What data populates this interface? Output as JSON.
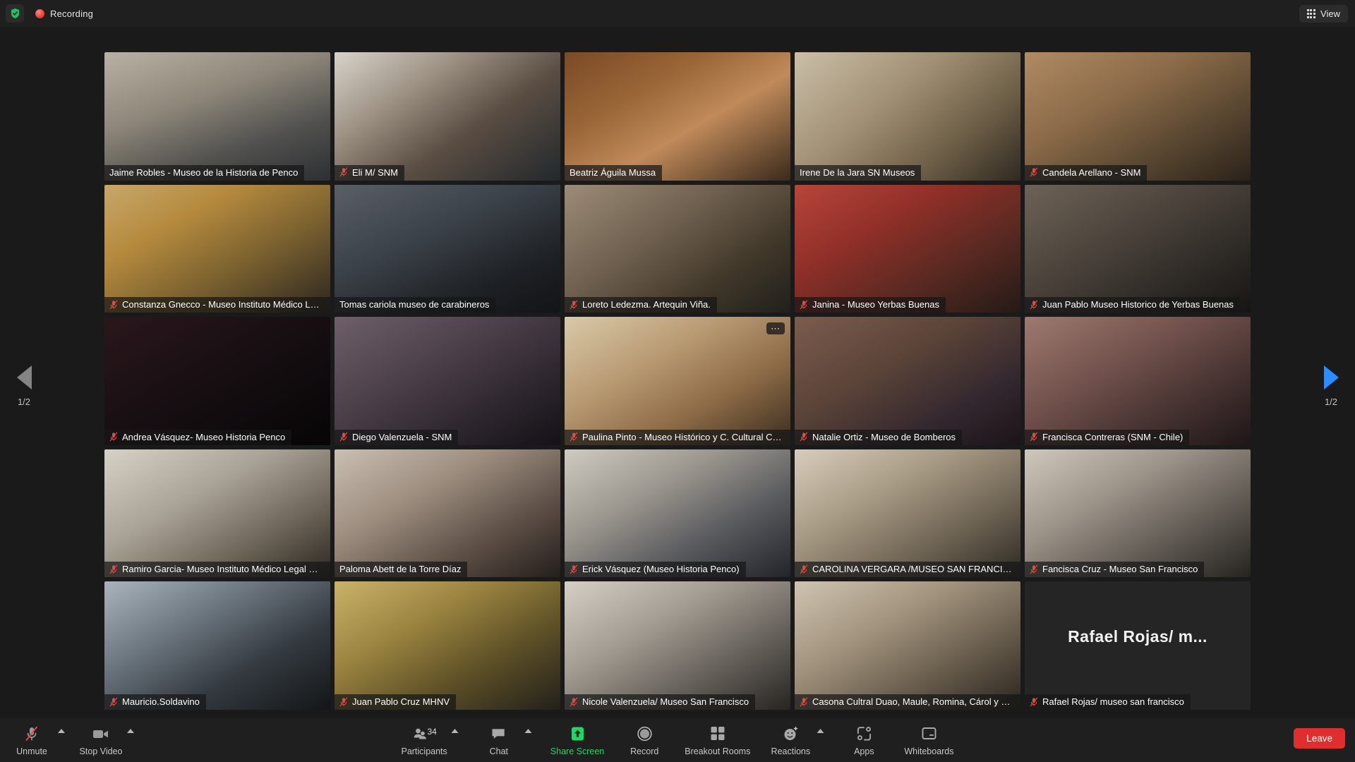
{
  "topbar": {
    "shield_icon": "shield-check-icon",
    "recording_label": "Recording",
    "view_label": "View",
    "view_icon": "grid-view-icon"
  },
  "pager": {
    "left_icon": "chevron-left-icon",
    "right_icon": "chevron-right-icon",
    "left_count": "1/2",
    "right_count": "1/2"
  },
  "tiles": [
    {
      "name": "Jaime Robles - Museo de la Historia de Penco",
      "muted": false,
      "speaking": false,
      "more": false,
      "bg": "linear-gradient(160deg,#b9b2a4 0%,#8d8679 38%,#50504e 70%,#2e2f33 100%)",
      "avatar": ""
    },
    {
      "name": "Eli M/ SNM",
      "muted": true,
      "speaking": false,
      "more": false,
      "bg": "linear-gradient(145deg,#d8d3cb 0%,#9f9486 30%,#5b4e43 60%,#22282c 100%)",
      "avatar": ""
    },
    {
      "name": "Beatriz Águila Mussa",
      "muted": false,
      "speaking": false,
      "more": false,
      "bg": "linear-gradient(150deg,#7a4a26 0%,#9a6637 32%,#c08a5a 58%,#3a2a1c 100%)",
      "avatar": ""
    },
    {
      "name": "Irene De la Jara SN Museos",
      "muted": false,
      "speaking": false,
      "more": false,
      "bg": "linear-gradient(140deg,#cbbfa8 0%,#a08f73 40%,#6b5c45 72%,#2f2a22 100%)",
      "avatar": ""
    },
    {
      "name": "Candela Arellano - SNM",
      "muted": true,
      "speaking": false,
      "more": false,
      "bg": "linear-gradient(150deg,#b08b63 0%,#8a6a48 38%,#5d4a33 66%,#2a2219 100%)",
      "avatar": ""
    },
    {
      "name": "Constanza Gnecco - Museo Instituto Médico Leg...",
      "muted": true,
      "speaking": false,
      "more": false,
      "bg": "linear-gradient(150deg,#c8a76a 0%,#b58a3e 30%,#7d6330 60%,#2b2620 100%)",
      "avatar": ""
    },
    {
      "name": "Tomas cariola museo de carabineros",
      "muted": false,
      "speaking": true,
      "more": false,
      "bg": "linear-gradient(155deg,#5a5f66 0%,#3b4148 40%,#1d2024 75%,#121417 100%)",
      "avatar": ""
    },
    {
      "name": "Loreto Ledezma. Artequin Viña.",
      "muted": true,
      "speaking": false,
      "more": false,
      "bg": "linear-gradient(145deg,#9c8b78 0%,#6e5f4e 40%,#403729 72%,#20201c 100%)",
      "avatar": ""
    },
    {
      "name": "Janina - Museo Yerbas Buenas",
      "muted": true,
      "speaking": false,
      "more": false,
      "bg": "linear-gradient(150deg,#b8453a 0%,#8f2f28 35%,#5b2a22 65%,#241a17 100%)",
      "avatar": ""
    },
    {
      "name": "Juan Pablo Museo Historico de Yerbas Buenas",
      "muted": true,
      "speaking": false,
      "more": false,
      "bg": "linear-gradient(150deg,#6d6257 0%,#4c443c 40%,#2e2a26 72%,#171513 100%)",
      "avatar": ""
    },
    {
      "name": "Andrea Vásquez- Museo Historia Penco",
      "muted": true,
      "speaking": false,
      "more": false,
      "bg": "linear-gradient(150deg,#2a171c 0%,#1a1014 40%,#0e0a0c 75%,#070506 100%)",
      "avatar": ""
    },
    {
      "name": "Diego Valenzuela - SNM",
      "muted": true,
      "speaking": false,
      "more": false,
      "bg": "linear-gradient(150deg,#6e5f6a 0%,#4b3f4a 40%,#2b242c 74%,#151116 100%)",
      "avatar": ""
    },
    {
      "name": "Paulina Pinto - Museo Histórico y C. Cultural Car...",
      "muted": true,
      "speaking": false,
      "more": true,
      "bg": "linear-gradient(150deg,#d9c9a8 0%,#b99b74 35%,#8e6c48 65%,#3a2c1e 100%)",
      "avatar": ""
    },
    {
      "name": "Natalie Ortiz - Museo de Bomberos",
      "muted": true,
      "speaking": false,
      "more": false,
      "bg": "linear-gradient(150deg,#7c5c4e 0%,#5a4338 40%,#34282f 72%,#1a1418 100%)",
      "avatar": ""
    },
    {
      "name": "Francisca Contreras (SNM - Chile)",
      "muted": true,
      "speaking": false,
      "more": false,
      "bg": "linear-gradient(150deg,#9e7a70 0%,#70504b 40%,#42302f 72%,#1e1617 100%)",
      "avatar": ""
    },
    {
      "name": "Ramiro Garcia- Museo Instituto Médico Legal Dr....",
      "muted": true,
      "speaking": false,
      "more": false,
      "bg": "linear-gradient(150deg,#d7d2c6 0%,#a9a396 38%,#6d6559 70%,#2b2721 100%)",
      "avatar": ""
    },
    {
      "name": "Paloma Abett de la Torre Díaz",
      "muted": false,
      "speaking": false,
      "more": false,
      "bg": "linear-gradient(150deg,#c9bfb2 0%,#9d8d7f 36%,#5f5148 68%,#241e1b 100%)",
      "avatar": ""
    },
    {
      "name": "Erick Vásquez (Museo Historia Penco)",
      "muted": true,
      "speaking": false,
      "more": false,
      "bg": "linear-gradient(150deg,#cfcac2 0%,#9b968e 35%,#5a5b5f 66%,#22242a 100%)",
      "avatar": ""
    },
    {
      "name": "CAROLINA VERGARA /MUSEO SAN FRANCISCO",
      "muted": true,
      "speaking": false,
      "more": false,
      "bg": "linear-gradient(150deg,#d7cdbb 0%,#a79a84 36%,#6e6454 68%,#2c2822 100%)",
      "avatar": ""
    },
    {
      "name": "Fancisca Cruz - Museo San Francisco",
      "muted": true,
      "speaking": false,
      "more": false,
      "bg": "linear-gradient(150deg,#cfc8bd 0%,#9c9389 36%,#605a53 68%,#262320 100%)",
      "avatar": ""
    },
    {
      "name": "Mauricio.Soldavino",
      "muted": true,
      "speaking": false,
      "more": false,
      "bg": "linear-gradient(150deg,#a9b4bd 0%,#6d7780 34%,#343a40 66%,#131618 100%)",
      "avatar": ""
    },
    {
      "name": "Juan Pablo Cruz MHNV",
      "muted": true,
      "speaking": false,
      "more": false,
      "bg": "linear-gradient(150deg,#c9b36a 0%,#9b8440 34%,#5d5027 66%,#22201a 100%)",
      "avatar": ""
    },
    {
      "name": "Nicole Valenzuela/ Museo San Francisco",
      "muted": true,
      "speaking": false,
      "more": false,
      "bg": "linear-gradient(150deg,#d5cfc6 0%,#a39c92 36%,#65605a 68%,#272421 100%)",
      "avatar": ""
    },
    {
      "name": "Casona Cultral Duao, Maule, Romina, Cárol y Carla",
      "muted": true,
      "speaking": false,
      "more": false,
      "bg": "linear-gradient(150deg,#cfc4b2 0%,#a2937d 36%,#675c4c 68%,#29241d 100%)",
      "avatar": ""
    },
    {
      "name": "Rafael Rojas/ museo san francisco",
      "muted": true,
      "speaking": false,
      "more": false,
      "bg": "#252526",
      "avatar": "Rafael Rojas/ m..."
    }
  ],
  "toolbar": {
    "unmute": {
      "label": "Unmute",
      "icon": "mic-off-icon"
    },
    "stop_video": {
      "label": "Stop Video",
      "icon": "video-icon"
    },
    "participants": {
      "label": "Participants",
      "icon": "participants-icon",
      "count": "34"
    },
    "chat": {
      "label": "Chat",
      "icon": "chat-bubble-icon"
    },
    "share_screen": {
      "label": "Share Screen",
      "icon": "share-screen-icon",
      "color": "#25d366"
    },
    "record": {
      "label": "Record",
      "icon": "record-circle-icon"
    },
    "breakout_rooms": {
      "label": "Breakout Rooms",
      "icon": "breakout-rooms-icon"
    },
    "reactions": {
      "label": "Reactions",
      "icon": "reactions-smiley-icon"
    },
    "apps": {
      "label": "Apps",
      "icon": "apps-icon"
    },
    "whiteboards": {
      "label": "Whiteboards",
      "icon": "whiteboard-icon"
    },
    "leave": {
      "label": "Leave"
    }
  }
}
